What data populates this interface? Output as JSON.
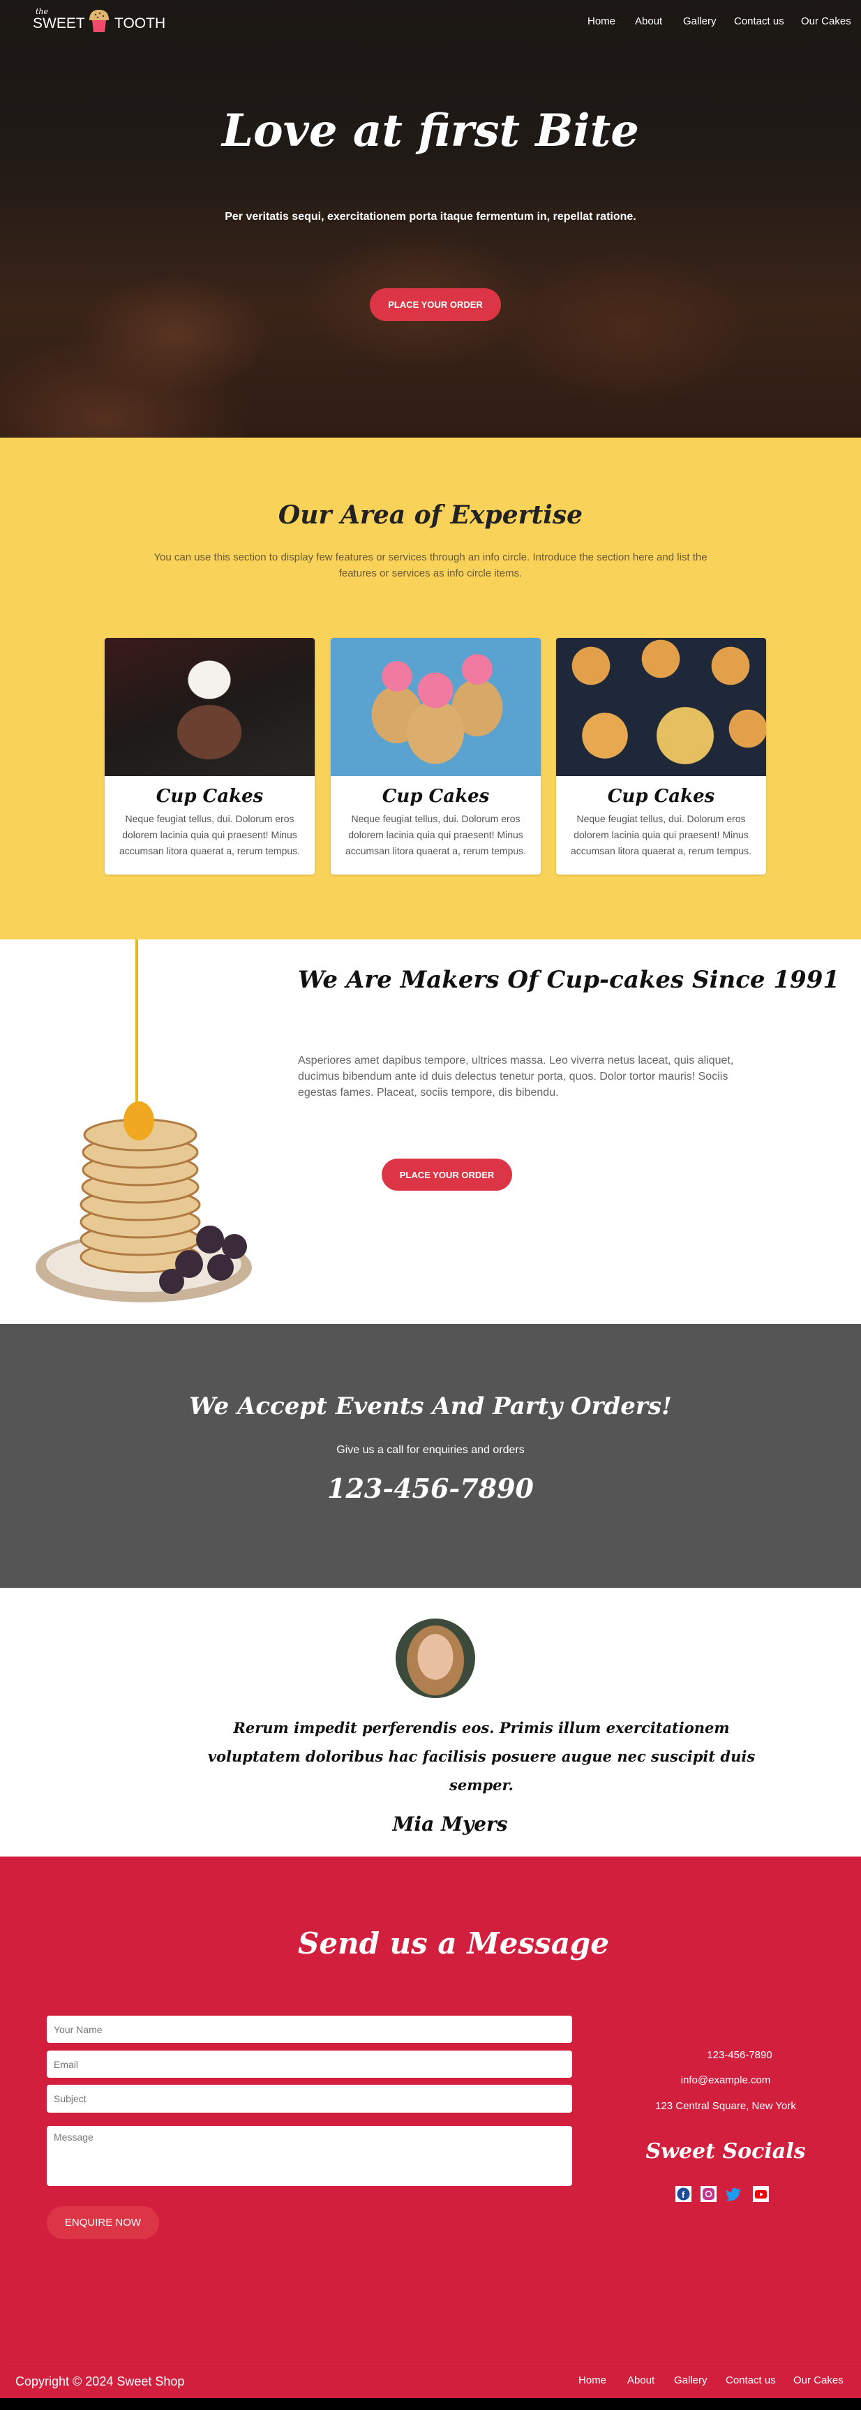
{
  "brand": {
    "small": "the",
    "name_left": "SWEET",
    "name_right": "TOOTH"
  },
  "nav": [
    "Home",
    "About",
    "Gallery",
    "Contact us",
    "Our Cakes"
  ],
  "hero": {
    "title": "Love at first Bite",
    "subtitle": "Per veritatis sequi, exercitationem porta itaque fermentum in, repellat ratione.",
    "cta": "PLACE YOUR ORDER"
  },
  "expertise": {
    "title": "Our Area of Expertise",
    "description": "You can use this section to display few features or services through an info circle. Introduce the section here and list the features or services as info circle items.",
    "cards": [
      {
        "title": "Cup Cakes",
        "text": "Neque feugiat tellus, dui. Dolorum eros dolorem lacinia quia qui praesent! Minus accumsan litora quaerat a, rerum tempus."
      },
      {
        "title": "Cup Cakes",
        "text": "Neque feugiat tellus, dui. Dolorum eros dolorem lacinia quia qui praesent! Minus accumsan litora quaerat a, rerum tempus."
      },
      {
        "title": "Cup Cakes",
        "text": "Neque feugiat tellus, dui. Dolorum eros dolorem lacinia quia qui praesent! Minus accumsan litora quaerat a, rerum tempus."
      }
    ]
  },
  "makers": {
    "title": "We Are Makers Of Cup-cakes Since 1991",
    "text": "Asperiores amet dapibus tempore, ultrices massa. Leo viverra netus laceat, quis aliquet, ducimus bibendum ante id duis delectus tenetur porta, quos. Dolor tortor mauris! Sociis egestas fames. Placeat, sociis tempore, dis bibendu.",
    "cta": "PLACE YOUR ORDER"
  },
  "events": {
    "title": "We Accept Events And Party Orders!",
    "subtitle": "Give us a call for enquiries and orders",
    "phone": "123-456-7890"
  },
  "testimonial": {
    "quote": "Rerum impedit perferendis eos. Primis illum exercitationem voluptatem doloribus hac facilisis posuere augue nec suscipit duis semper.",
    "author": "Mia Myers"
  },
  "contact": {
    "title": "Send us a Message",
    "form": {
      "name_placeholder": "Your Name",
      "email_placeholder": "Email",
      "subject_placeholder": "Subject",
      "message_placeholder": "Message",
      "submit": "ENQUIRE NOW"
    },
    "phone": "123-456-7890",
    "email": "info@example.com",
    "address": "123 Central Square, New York",
    "socials_title": "Sweet Socials",
    "socials": [
      "facebook",
      "instagram",
      "twitter",
      "youtube"
    ]
  },
  "footer": {
    "copyright": "Copyright © 2024 Sweet Shop",
    "links": [
      "Home",
      "About",
      "Gallery",
      "Contact us",
      "Our Cakes"
    ]
  },
  "colors": {
    "yellow": "#f9d25a",
    "red": "#d31f3e",
    "button": "#dc3545",
    "gray": "#555555"
  }
}
